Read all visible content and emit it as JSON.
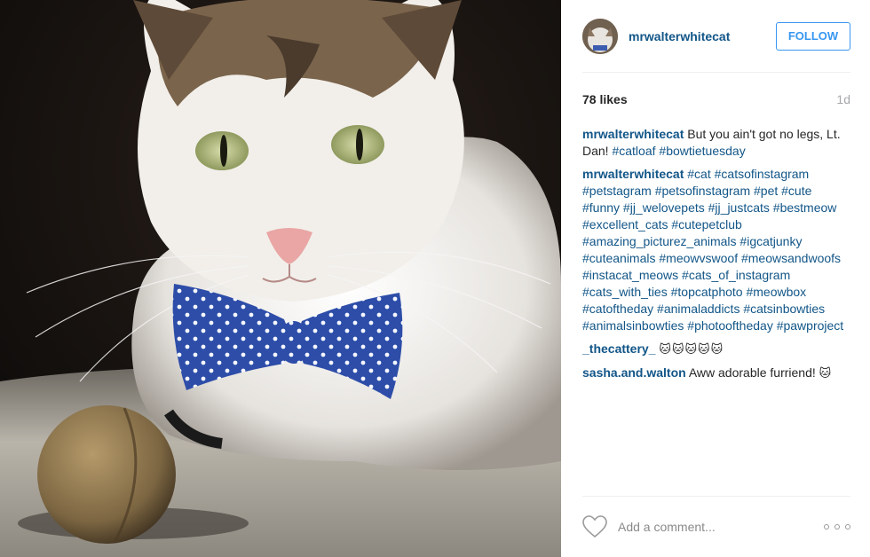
{
  "post": {
    "username": "mrwalterwhitecat",
    "follow_label": "FOLLOW",
    "likes": "78 likes",
    "time_ago": "1d"
  },
  "comments": [
    {
      "user": "mrwalterwhitecat",
      "text": " But you ain't got no legs, Lt. Dan! ",
      "tags": [
        "#catloaf",
        " #bowtietuesday"
      ]
    },
    {
      "user": "mrwalterwhitecat",
      "text": " ",
      "tags": [
        "#cat #catsofinstagram #petstagram #petsofinstagram #pet #cute #funny #jj_welovepets #jj_justcats #bestmeow #excellent_cats #cutepetclub #amazing_picturez_animals #igcatjunky #cuteanimals #meowvswoof #meowsandwoofs #instacat_meows #cats_of_instagram #cats_with_ties #topcatphoto #meowbox #catoftheday #animaladdicts #catsinbowties #animalsinbowties #photooftheday #pawproject"
      ]
    },
    {
      "user": "_thecattery_",
      "text": " ",
      "emoji": "🐱🐱🐱🐱🐱"
    },
    {
      "user": "sasha.and.walton",
      "text": " Aww adorable furriend! ",
      "emoji": "🐱"
    }
  ],
  "comment_box": {
    "placeholder": "Add a comment..."
  },
  "icons": {
    "like": "heart-icon",
    "more": "more-options-icon"
  },
  "colors": {
    "link": "#125688",
    "follow": "#3897f0",
    "muted": "#a5a7aa"
  }
}
